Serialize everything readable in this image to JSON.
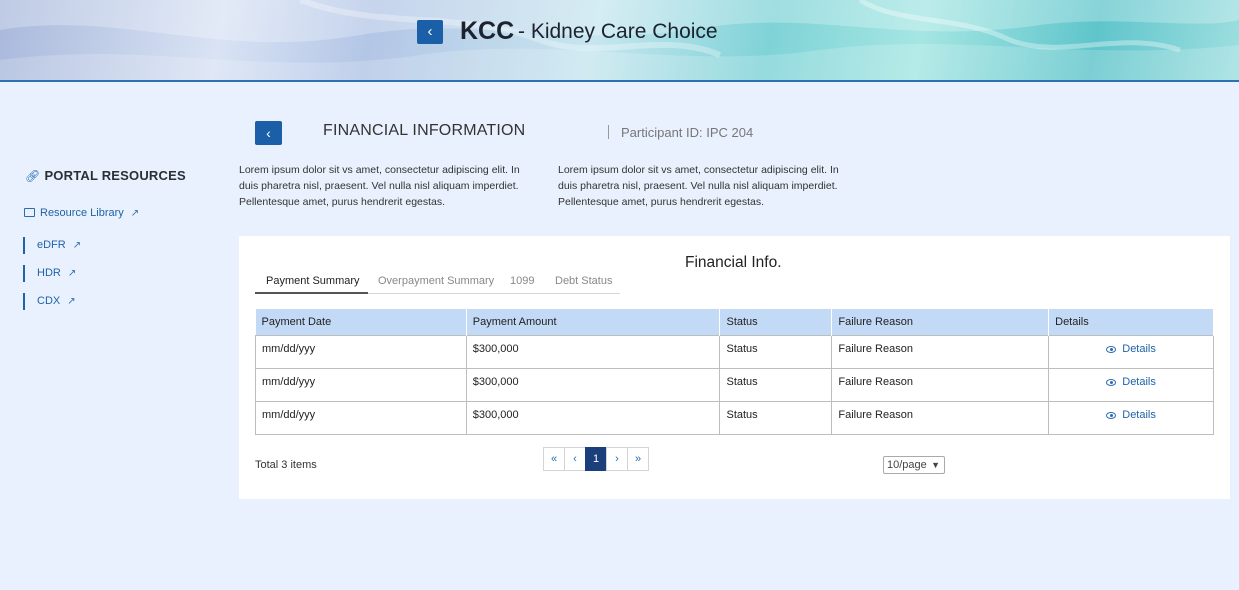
{
  "header": {
    "brand": "KCC",
    "subtitle": "- Kidney Care Choice",
    "back_icon": "chevron-left-icon"
  },
  "sidebar": {
    "title": "PORTAL RESOURCES",
    "title_icon": "link-icon",
    "library": {
      "label": "Resource Library",
      "icon": "book-icon",
      "ext_icon": "external-link-icon"
    },
    "items": [
      {
        "label": "eDFR"
      },
      {
        "label": "HDR"
      },
      {
        "label": "CDX"
      }
    ]
  },
  "page": {
    "title": "FINANCIAL INFORMATION",
    "participant": "Participant ID: IPC 204",
    "para1": "Lorem ipsum dolor sit vs amet, consectetur adipiscing elit. In duis pharetra nisl, praesent. Vel nulla nisl aliquam imperdiet. Pellentesque amet, purus hendrerit egestas.",
    "para2": "Lorem ipsum dolor sit vs amet, consectetur adipiscing elit. In duis pharetra nisl, praesent. Vel nulla nisl aliquam imperdiet. Pellentesque amet, purus hendrerit egestas."
  },
  "card": {
    "title": "Financial Info.",
    "tabs": [
      "Payment Summary",
      "Overpayment Summary",
      "1099",
      "Debt Status"
    ],
    "columns": [
      "Payment Date",
      "Payment Amount",
      "Status",
      "Failure Reason",
      "Details"
    ],
    "rows": [
      {
        "date": "mm/dd/yyy",
        "amount": "$300,000",
        "status": "Status",
        "reason": "Failure Reason",
        "details": "Details"
      },
      {
        "date": "mm/dd/yyy",
        "amount": "$300,000",
        "status": "Status",
        "reason": "Failure Reason",
        "details": "Details"
      },
      {
        "date": "mm/dd/yyy",
        "amount": "$300,000",
        "status": "Status",
        "reason": "Failure Reason",
        "details": "Details"
      }
    ],
    "total": "Total 3 items",
    "pager": {
      "first": "«",
      "prev": "‹",
      "current": "1",
      "next": "›",
      "last": "»"
    },
    "per_page": "10/page"
  }
}
